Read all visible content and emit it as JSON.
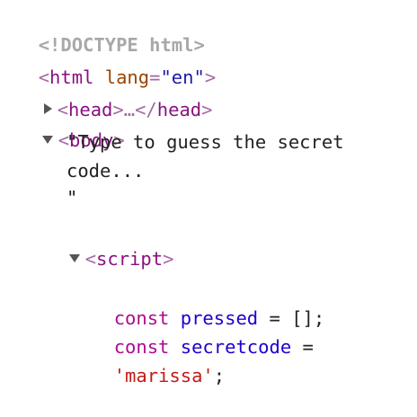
{
  "doctype": "<!DOCTYPE html>",
  "html_open": {
    "open": "<",
    "tag": "html",
    "attr_name": "lang",
    "eq": "=",
    "attr_value": "\"en\"",
    "close": ">"
  },
  "head": {
    "open": "<",
    "tag": "head",
    "mid": ">…</",
    "tag2": "head",
    "close": ">"
  },
  "body": {
    "open": "<",
    "tag": "body",
    "close": ">"
  },
  "text_node": {
    "line1": "\"Type to guess the secret",
    "line2": "code...",
    "line3": "\""
  },
  "script": {
    "open": "<",
    "tag": "script",
    "close": ">"
  },
  "code": {
    "line1_kw": "const",
    "line1_ident": "pressed",
    "line1_op": "=",
    "line1_rest": "[];",
    "line2_kw": "const",
    "line2_ident": "secretcode",
    "line2_op": "=",
    "line3_str": "'marissa'",
    "line3_punct": ";"
  }
}
